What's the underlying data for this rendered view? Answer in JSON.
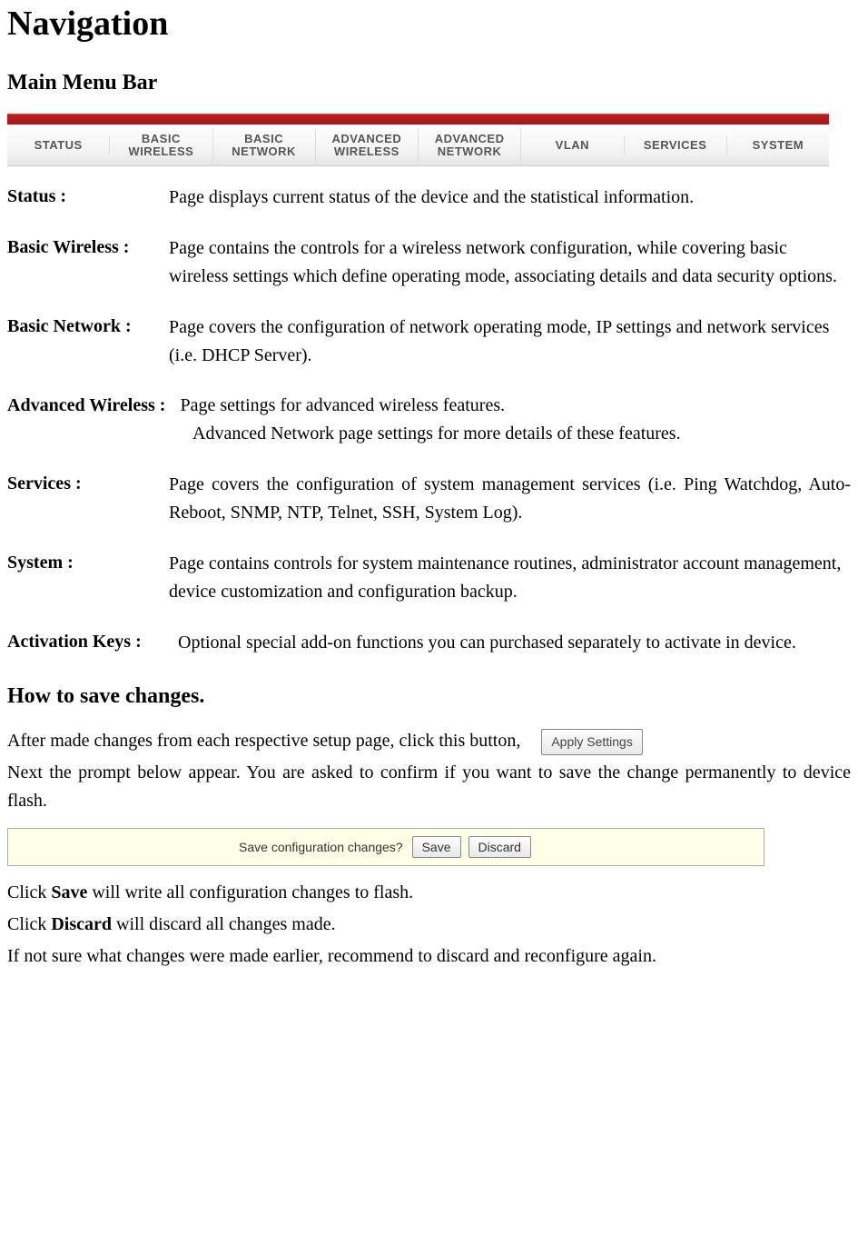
{
  "title": "Navigation",
  "section1": "Main Menu Bar",
  "tabs": [
    "STATUS",
    "BASIC\nWIRELESS",
    "BASIC\nNETWORK",
    "ADVANCED\nWIRELESS",
    "ADVANCED\nNETWORK",
    "VLAN",
    "SERVICES",
    "SYSTEM"
  ],
  "items": {
    "status": {
      "label": "Status :",
      "text": "Page displays current status of the device and the statistical information."
    },
    "basic_wireless": {
      "label": "Basic Wireless :",
      "text": "Page contains the controls for a wireless network configuration, while covering basic wireless settings which define operating mode, associating details and data security options."
    },
    "basic_network": {
      "label": "Basic Network :",
      "text": "Page covers the configuration of network operating mode, IP settings and network services (i.e. DHCP Server)."
    },
    "advanced_wireless": {
      "label": "Advanced Wireless :",
      "line1": "Page settings for advanced wireless features.",
      "line2": "Advanced Network page settings for more details of these features."
    },
    "services": {
      "label": "Services :",
      "text": "Page covers the configuration of system management services (i.e. Ping Watchdog, Auto-Reboot, SNMP, NTP, Telnet, SSH, System Log)."
    },
    "system": {
      "label": "System :",
      "text": "Page contains controls for system maintenance routines, administrator account management, device customization and configuration backup."
    },
    "activation": {
      "label": "Activation Keys :",
      "text": "Optional special add-on functions you can purchased separately to activate in device."
    }
  },
  "section2": "How to save changes.",
  "save": {
    "intro": "After made changes from each respective setup page, click this button,",
    "apply_button": "Apply Settings",
    "next": "Next the prompt below appear. You are asked to confirm if you want to save the change permanently to device flash.",
    "bar_prompt": "Save configuration changes?",
    "save_btn": "Save",
    "discard_btn": "Discard",
    "line_save_pre": "Click ",
    "line_save_bold": "Save",
    "line_save_post": " will write all configuration changes to flash.",
    "line_discard_pre": "Click ",
    "line_discard_bold": "Discard",
    "line_discard_post": " will discard all changes made.",
    "line_note": "If not sure what changes were made earlier, recommend to discard and reconfigure again."
  }
}
